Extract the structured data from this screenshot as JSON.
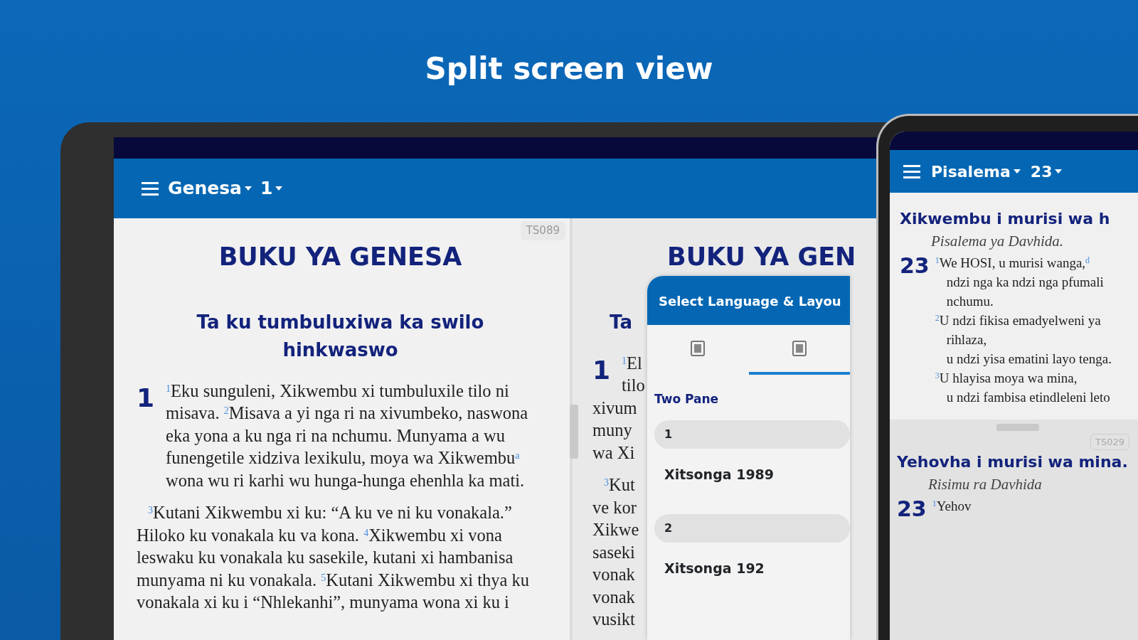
{
  "headline": "Split screen view",
  "tablet": {
    "app_bar": {
      "book": "Genesa",
      "chapter": "1"
    },
    "left_pane": {
      "badge": "TS089",
      "title": "BUKU YA GENESA",
      "heading": "Ta ku tumbuluxiwa ka swilo hinkwaswo",
      "chapter": "1",
      "paragraphs": [
        "$^{1}$Eku sunguleni, Xikwembu xi tumbuluxile tilo ni misava. $^{2}$Misava a yi nga ri na xivumbeko, naswona eka yona a ku nga ri na nchumu. Munyama a wu funengetile xidziva lexikulu, moya wa Xikwembu$^{a}$ wona wu ri karhi wu hunga-hunga ehenhla ka mati.",
        "$^{3}$Kutani Xikwembu xi ku: “A ku ve ni ku vonakala.” Hiloko ku vonakala ku va kona. $^{4}$Xikwembu xi vona leswaku ku vonakala ku sasekile, kutani xi hambanisa munyama ni ku vonakala. $^{5}$Kutani Xikwembu xi thya ku vonakala xi ku i “Nhlekanhi”, munyama wona xi ku i"
      ]
    },
    "right_pane": {
      "title": "BUKU YA GEN",
      "heading": "Ta",
      "chapter": "1",
      "lines": [
        "$^{1}$El",
        "tilo",
        "xivum",
        "muny",
        "wa Xi",
        "$^{3}$Kut",
        "ve kor",
        "Xikwe",
        "saseki",
        "vonak",
        "vonak",
        "vusikt"
      ]
    },
    "dialog": {
      "title": "Select Language & Layou",
      "tabs": [
        {
          "selected": false
        },
        {
          "selected": true
        }
      ],
      "section": "Two Pane",
      "panes": [
        {
          "number": "1",
          "language": "Xitsonga 1989"
        },
        {
          "number": "2",
          "language": "Xitsonga 192"
        }
      ]
    }
  },
  "phone": {
    "app_bar": {
      "book": "Pisalema",
      "chapter": "23"
    },
    "top_pane": {
      "title": "Xikwembu i murisi wa h",
      "subtitle": "Pisalema ya Davhida.",
      "chapter": "23",
      "lines": [
        "$^{1}$We HOSI, u murisi wanga,$^{d}$",
        "ndzi nga ka ndzi nga pfumali",
        "nchumu.",
        "$^{2}$U ndzi fikisa emadyelweni ya",
        "rihlaza,",
        "u ndzi yisa ematini layo tenga.",
        "$^{3}$U hlayisa moya wa mina,",
        "u ndzi fambisa etindleleni leto"
      ]
    },
    "bottom_pane": {
      "badge": "TS029",
      "title": "Yehovha i murisi wa mina.",
      "subtitle": "Risimu ra Davhida",
      "chapter": "23",
      "lines": [
        "$^{1}$Yehov"
      ]
    }
  }
}
